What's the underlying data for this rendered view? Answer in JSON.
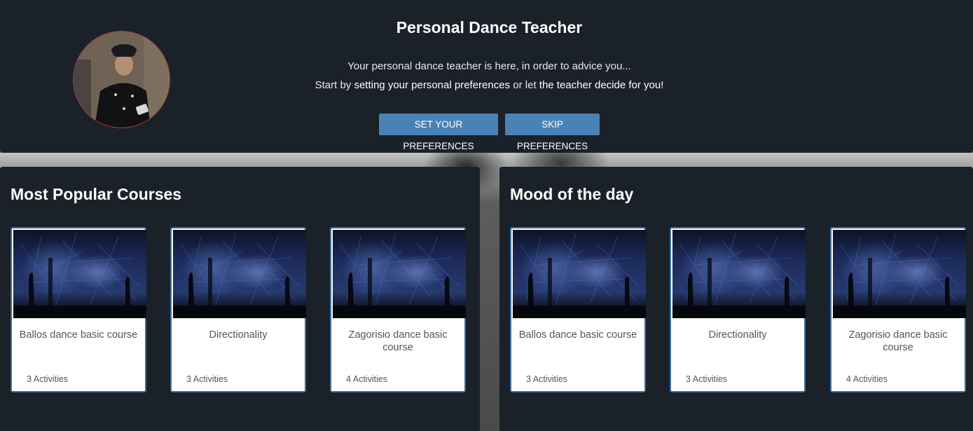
{
  "hero": {
    "title": "Personal Dance Teacher",
    "line1": "Your personal dance teacher is here, in order to advice you...",
    "line2_prefix": "Start by ",
    "line2_em1": "setting your personal preferences",
    "line2_mid": " or let ",
    "line2_em2": "the teacher decide for you!",
    "set_button": "SET YOUR PREFERENCES",
    "skip_button": "SKIP PREFERENCES"
  },
  "sections": [
    {
      "title": "Most Popular Courses",
      "courses": [
        {
          "name": "Ballos dance basic course",
          "activities": "3 Activities"
        },
        {
          "name": "Directionality",
          "activities": "3 Activities"
        },
        {
          "name": "Zagorisio dance basic course",
          "activities": "4 Activities"
        }
      ]
    },
    {
      "title": "Mood of the day",
      "courses": [
        {
          "name": "Ballos dance basic course",
          "activities": "3 Activities"
        },
        {
          "name": "Directionality",
          "activities": "3 Activities"
        },
        {
          "name": "Zagorisio dance basic course",
          "activities": "4 Activities"
        }
      ]
    }
  ],
  "colors": {
    "panel_bg": "#1b2129",
    "button_bg": "#4b82b5",
    "card_border": "#3c6f9c"
  }
}
